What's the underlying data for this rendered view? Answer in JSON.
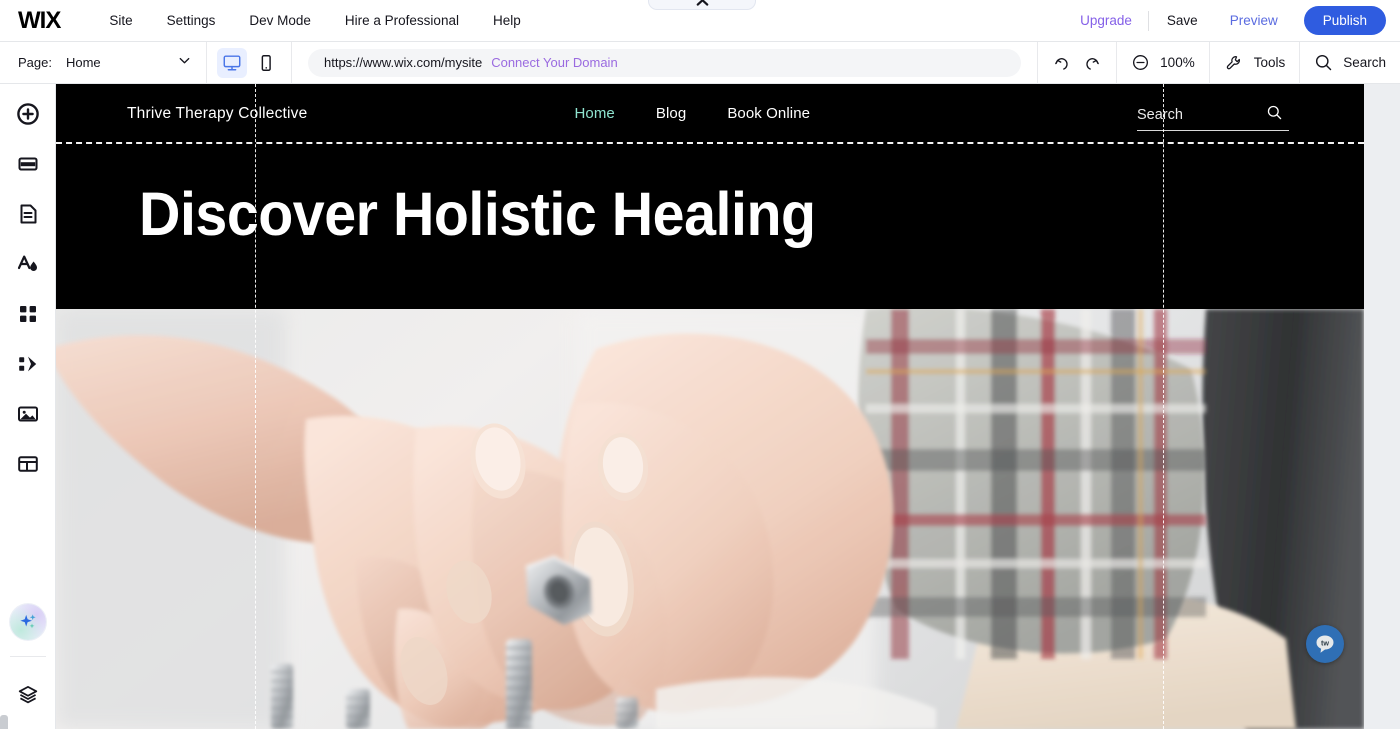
{
  "editor": {
    "brand": "WIX",
    "menu": [
      {
        "label": "Site",
        "name": "menu-site"
      },
      {
        "label": "Settings",
        "name": "menu-settings"
      },
      {
        "label": "Dev Mode",
        "name": "menu-dev-mode"
      },
      {
        "label": "Hire a Professional",
        "name": "menu-hire-professional"
      },
      {
        "label": "Help",
        "name": "menu-help"
      }
    ],
    "actions": {
      "upgrade": "Upgrade",
      "save": "Save",
      "preview": "Preview",
      "publish": "Publish"
    },
    "colors": {
      "publish_bg": "#2f5ce0",
      "upgrade_text": "#8560e8",
      "preview_text": "#5a6be0",
      "domain_link": "#9a6ae0",
      "device_active_bg": "#e9efff",
      "device_active_icon": "#4a76e8"
    }
  },
  "toolbar": {
    "page_label": "Page:",
    "page_value": "Home",
    "devices": [
      {
        "name": "desktop-view-button",
        "icon": "monitor-icon",
        "active": true
      },
      {
        "name": "mobile-view-button",
        "icon": "phone-icon",
        "active": false
      }
    ],
    "url": "https://www.wix.com/mysite",
    "connect_domain": "Connect Your Domain",
    "undo": "undo-icon",
    "redo": "redo-icon",
    "zoom_level": "100%",
    "tools_label": "Tools",
    "search_label": "Search"
  },
  "sidebar": {
    "items": [
      {
        "label": "Add Elements",
        "icon": "plus-circle-icon"
      },
      {
        "label": "Add Section",
        "icon": "section-icon"
      },
      {
        "label": "Pages and Menu",
        "icon": "pages-icon"
      },
      {
        "label": "Site Design",
        "icon": "theme-paint-icon"
      },
      {
        "label": "Apps",
        "icon": "apps-grid-icon"
      },
      {
        "label": "Media",
        "icon": "interactions-icon"
      },
      {
        "label": "My Uploads",
        "icon": "image-icon"
      },
      {
        "label": "Content Manager",
        "icon": "database-table-icon"
      }
    ],
    "ai_assistant": {
      "label": "AI Assistant",
      "icon": "ai-sparkle-icon"
    },
    "layers": {
      "label": "Layers",
      "icon": "layers-icon"
    }
  },
  "site": {
    "brand_name": "Thrive Therapy Collective",
    "nav": [
      {
        "label": "Home",
        "current": true
      },
      {
        "label": "Blog",
        "current": false
      },
      {
        "label": "Book Online",
        "current": false
      }
    ],
    "search_placeholder": "Search",
    "search_icon": "magnifier-icon",
    "hero_title": "Discover Holistic Healing",
    "hero_bg": "#000000",
    "nav_active_color": "#8fe3cf",
    "chat_widget": {
      "name": "chat-widget",
      "icon": "speech-bubble-icon",
      "color": "#2f6fb5"
    }
  }
}
